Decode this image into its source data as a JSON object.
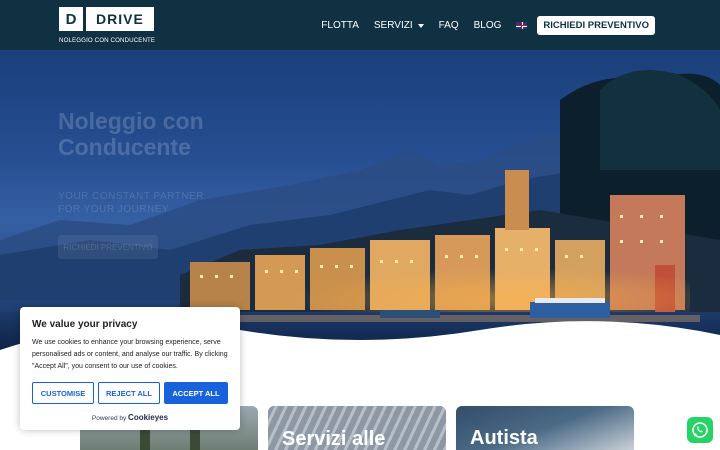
{
  "header": {
    "logo_letter": "D",
    "logo_name": "DRIVE",
    "logo_subtitle": "NOLEGGIO CON CONDUCENTE",
    "nav": [
      {
        "label": "FLOTTA"
      },
      {
        "label": "SERVIZI"
      },
      {
        "label": "FAQ"
      },
      {
        "label": "BLOG"
      }
    ],
    "language_flag": "uk-flag-icon",
    "cta_label": "RICHIEDI PREVENTIVO"
  },
  "hero": {
    "title": "Noleggio con Conducente",
    "subtitle": "YOUR CONSTANT PARTNER FOR YOUR JOURNEY",
    "button_label": "RICHIEDI PREVENTIVO"
  },
  "cards": [
    {
      "title": ""
    },
    {
      "title": "Servizi alle"
    },
    {
      "title": "Autista"
    }
  ],
  "cookie": {
    "title": "We value your privacy",
    "text": "We use cookies to enhance your browsing experience, serve personalised ads or content, and analyse our traffic. By clicking \"Accept All\", you consent to our use of cookies.",
    "customise_label": "CUSTOMISE",
    "reject_label": "REJECT ALL",
    "accept_label": "ACCEPT ALL",
    "powered_prefix": "Powered by",
    "powered_brand": "Cookieyes"
  },
  "whatsapp": {
    "icon": "whatsapp-icon"
  },
  "colors": {
    "header_bg": "#0f3142",
    "cookie_accent": "#1863dc",
    "whatsapp": "#25d366"
  }
}
